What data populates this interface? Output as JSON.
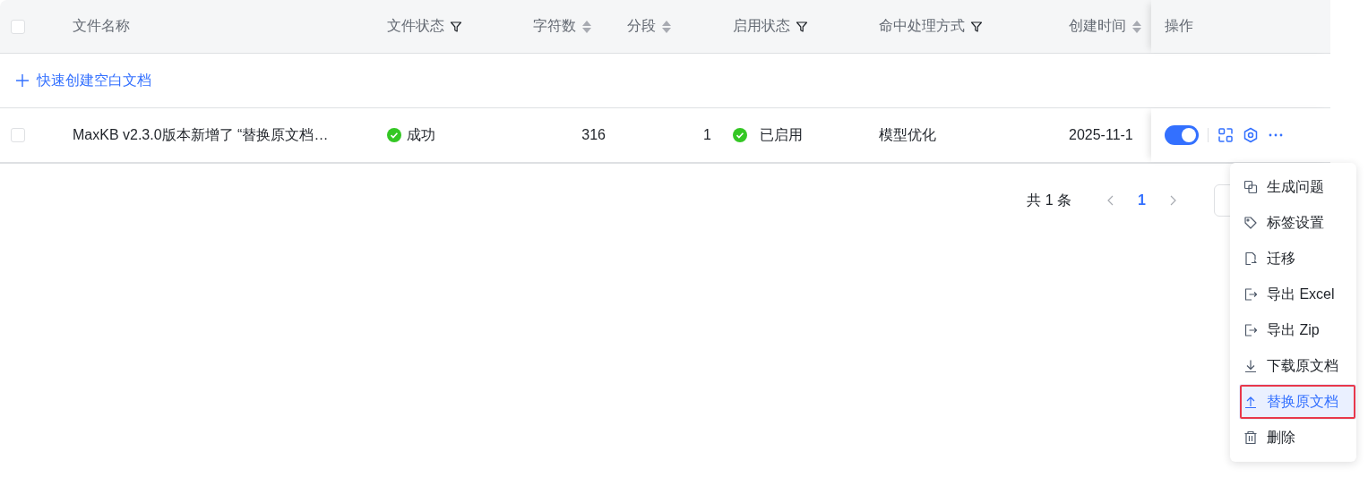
{
  "table": {
    "select_all": {
      "checked": false
    },
    "columns": [
      {
        "label": "文件名称",
        "kind": "plain"
      },
      {
        "label": "文件状态",
        "kind": "filter"
      },
      {
        "label": "字符数",
        "kind": "sort"
      },
      {
        "label": "分段",
        "kind": "sort"
      },
      {
        "label": "启用状态",
        "kind": "filter"
      },
      {
        "label": "命中处理方式",
        "kind": "filter"
      },
      {
        "label": "创建时间",
        "kind": "sort"
      },
      {
        "label": "操作",
        "kind": "plain"
      }
    ],
    "quick_create": "快速创建空白文档",
    "rows": [
      {
        "checked": false,
        "name": "MaxKB v2.3.0版本新增了 “替换原文档…",
        "status": "成功",
        "chars": "316",
        "segments": "1",
        "enabled": "已启用",
        "hit_method": "模型优化",
        "created": "2025-11-1",
        "toggle_on": true
      }
    ]
  },
  "pagination": {
    "total": "共 1 条",
    "pages": [
      {
        "label": "1",
        "selected": true
      }
    ]
  },
  "menu": {
    "items": [
      {
        "kind": "copy",
        "label": "生成问题",
        "selected": false
      },
      {
        "kind": "tag",
        "label": "标签设置",
        "selected": false
      },
      {
        "kind": "migrate",
        "label": "迁移",
        "selected": false
      },
      {
        "kind": "export",
        "label": "导出 Excel",
        "selected": false
      },
      {
        "kind": "export",
        "label": "导出 Zip",
        "selected": false
      },
      {
        "kind": "download",
        "label": "下载原文档",
        "selected": false
      },
      {
        "kind": "upload",
        "label": "替换原文档",
        "selected": true
      },
      {
        "kind": "trash",
        "label": "删除",
        "selected": false
      }
    ]
  }
}
